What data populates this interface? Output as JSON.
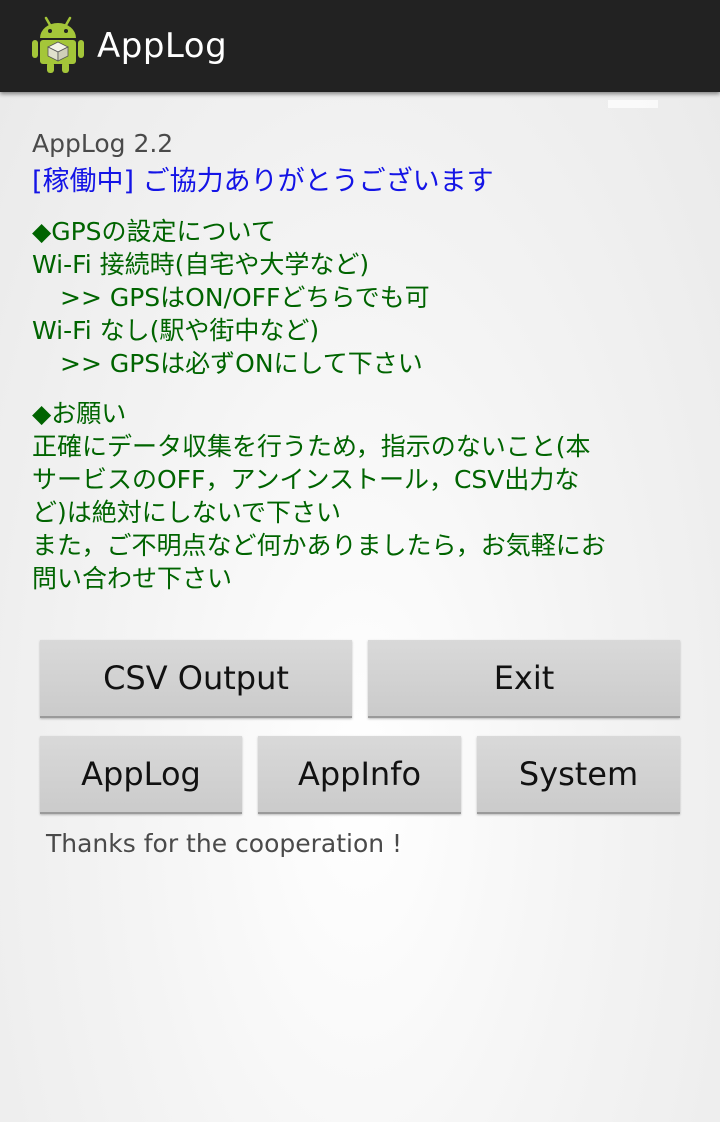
{
  "app_bar": {
    "title": "AppLog",
    "icon": "android-robot-icon"
  },
  "main": {
    "version": "AppLog 2.2",
    "status": "[稼働中]  ご協力ありがとうございます",
    "gps_section": {
      "heading": "◆GPSの設定について",
      "wifi_connected": "Wi-Fi 接続時(自宅や大学など)",
      "wifi_connected_note": ">>  GPSはON/OFFどちらでも可",
      "wifi_none": "Wi-Fi なし(駅や街中など)",
      "wifi_none_note": ">>  GPSは必ずONにして下さい"
    },
    "request_section": {
      "heading": "◆お願い",
      "line1": "正確にデータ収集を行うため，指示のないこと(本",
      "line2": "サービスのOFF，アンインストール，CSV出力な",
      "line3": "ど)は絶対にしないで下さい",
      "line4": "また，ご不明点など何かありましたら，お気軽にお",
      "line5": "問い合わせ下さい"
    },
    "buttons": {
      "csv_output": "CSV Output",
      "exit": "Exit",
      "applog": "AppLog",
      "appinfo": "AppInfo",
      "system": "System"
    },
    "footer_text": "Thanks for the cooperation !"
  },
  "colors": {
    "action_bar": "#222222",
    "status_text": "#1414e6",
    "notice_text": "#006400",
    "android_green": "#a4c639"
  }
}
